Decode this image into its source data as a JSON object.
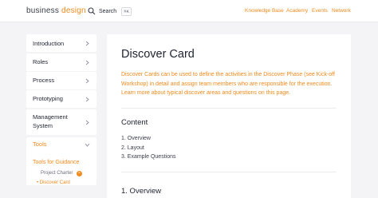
{
  "header": {
    "logo_word1": "business",
    "logo_word2": " design",
    "search_label": "Search",
    "search_shortcut": "⌘K",
    "nav": {
      "knowledge_base": "Knowledge Base",
      "academy": "Academy",
      "events": "Events",
      "network": "Network"
    }
  },
  "sidebar": {
    "items": [
      {
        "label": "Introduction"
      },
      {
        "label": "Roles"
      },
      {
        "label": "Process"
      },
      {
        "label": "Prototyping"
      },
      {
        "label_line1": "Management",
        "label_line2": "System"
      },
      {
        "label": "Tools"
      }
    ],
    "sub": {
      "group_label": "Tools for Guidance",
      "project_charter": "Project Charter",
      "project_charter_badge": "×",
      "discover_card": "• Discover Card"
    }
  },
  "main": {
    "title": "Discover Card",
    "intro": "Discover Cards can be used to define the activities in the Discover Phase (see Kick-off Workshop) in detail and assign team members who are responsible for the execution. Learn more about typical discover areas and questions on this page.",
    "content_heading": "Content",
    "toc": [
      "1. Overview",
      "2. Layout",
      "3. Example Questions"
    ],
    "section1_heading": "1. Overview"
  },
  "colors": {
    "accent": "#f08a1c",
    "text": "#1f2230",
    "background": "#f4f4f6"
  }
}
